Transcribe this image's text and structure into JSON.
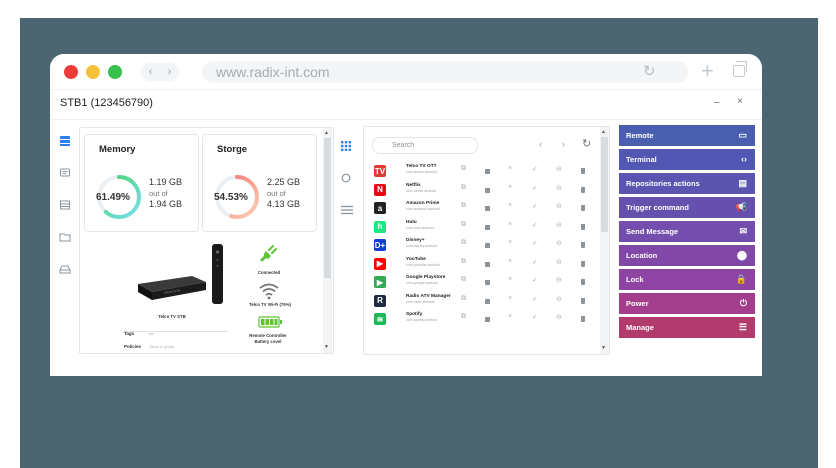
{
  "browser": {
    "url": "www.radix-int.com",
    "traffic_lights": [
      "#f03b3b",
      "#f7c23b",
      "#37c24f"
    ],
    "nav_back": "‹",
    "nav_forward": "›"
  },
  "window": {
    "title": "STB1 (123456790)",
    "minimize": "–",
    "close": "×"
  },
  "sidebar": {
    "icons": [
      "server-icon",
      "message-icon",
      "list-icon",
      "folder-icon",
      "drive-icon"
    ]
  },
  "memory": {
    "title": "Memory",
    "percent": "61.49%",
    "used": "1.19 GB",
    "of": "out of",
    "total": "1.94 GB",
    "fraction": 0.6149
  },
  "storage": {
    "title": "Storge",
    "percent": "54.53%",
    "used": "2.25 GB",
    "of": "out of",
    "total": "4.13 GB",
    "fraction": 0.5453
  },
  "device_info": {
    "device_name": "Telco TV STB",
    "box_label": "SMARTSTB",
    "connection": "Connected",
    "wifi": "Telco TV Wi-Fi (75%)",
    "remote": "Remote Controller Battery Level",
    "tags_label": "Tags",
    "tags_value": "stb",
    "policies_label": "Policies",
    "policies_value": "Show to group"
  },
  "apps": {
    "search_placeholder": "Search",
    "prev": "‹",
    "next": "›",
    "refresh": "↻",
    "list": [
      {
        "name": "Telco TV OTT",
        "sub": "com.telcotv.android",
        "logo": "TV",
        "color": "#e53935"
      },
      {
        "name": "Netflix",
        "sub": "com.netflix.android",
        "logo": "N",
        "color": "#e50914"
      },
      {
        "name": "Amazon Prime",
        "sub": "com.amazon.android",
        "logo": "a",
        "color": "#222222"
      },
      {
        "name": "Hulu",
        "sub": "com.hulu.android",
        "logo": "h",
        "color": "#1ce783"
      },
      {
        "name": "Disney+",
        "sub": "com.disney.android",
        "logo": "D+",
        "color": "#113ccf"
      },
      {
        "name": "YouTube",
        "sub": "com.youtube.android",
        "logo": "▶",
        "color": "#ff0000"
      },
      {
        "name": "Google Playstore",
        "sub": "com.google.android",
        "logo": "▶",
        "color": "#34a853"
      },
      {
        "name": "Radio ATV Manager",
        "sub": "com.radix.android",
        "logo": "R",
        "color": "#1f2a44"
      },
      {
        "name": "Spotify",
        "sub": "com.spotify.android",
        "logo": "≋",
        "color": "#1db954"
      }
    ]
  },
  "actions": [
    {
      "label": "Remote",
      "icon": "▭",
      "icon_name": "monitor-icon",
      "color": "#4a5fb0"
    },
    {
      "label": "Terminal",
      "icon": "‹›",
      "icon_name": "code-icon",
      "color": "#5157b2"
    },
    {
      "label": "Repositories actions",
      "icon": "▤",
      "icon_name": "clipboard-icon",
      "color": "#5b55b0"
    },
    {
      "label": "Trigger command",
      "icon": "📢",
      "icon_name": "megaphone-icon",
      "color": "#6650ae"
    },
    {
      "label": "Send Message",
      "icon": "✉",
      "icon_name": "mail-icon",
      "color": "#744eac"
    },
    {
      "label": "Location",
      "icon": "⬤",
      "icon_name": "location-pin-icon",
      "color": "#8148a8"
    },
    {
      "label": "Lock",
      "icon": "🔒",
      "icon_name": "lock-icon",
      "color": "#8d44a3"
    },
    {
      "label": "Power",
      "icon": "⏻",
      "icon_name": "power-icon",
      "color": "#a23e8b"
    },
    {
      "label": "Manage",
      "icon": "☰",
      "icon_name": "manage-list-icon",
      "color": "#b33a6c"
    }
  ]
}
